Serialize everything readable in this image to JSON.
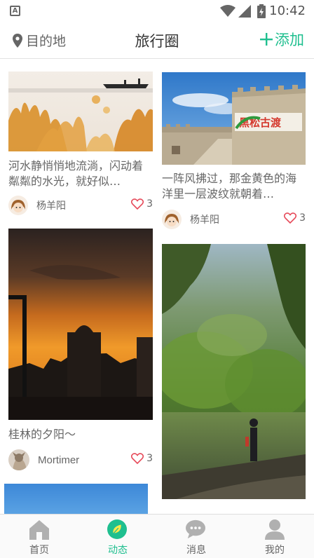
{
  "status_bar": {
    "time": "10:42"
  },
  "header": {
    "location_label": "目的地",
    "title": "旅行圈",
    "add_label": "添加"
  },
  "feed": {
    "left_column": [
      {
        "caption": "河水静悄悄地流淌，闪动着粼粼的水光，就好似…",
        "author": "杨羊阳",
        "likes": "3"
      },
      {
        "caption": "桂林的夕阳～",
        "author": "Mortimer",
        "likes": "3"
      }
    ],
    "right_column": [
      {
        "caption": "一阵风拂过，那金黄色的海洋里一层波纹就朝着…",
        "author": "杨羊阳",
        "likes": "3",
        "sign_text": "黑松古渡"
      }
    ]
  },
  "bottom_nav": [
    {
      "label": "首页",
      "icon": "home-icon",
      "active": false
    },
    {
      "label": "动态",
      "icon": "leaf-icon",
      "active": true
    },
    {
      "label": "消息",
      "icon": "message-icon",
      "active": false
    },
    {
      "label": "我的",
      "icon": "profile-icon",
      "active": false
    }
  ],
  "colors": {
    "accent": "#1fbf8f",
    "like": "#e64a5a",
    "text_secondary": "#666666"
  }
}
